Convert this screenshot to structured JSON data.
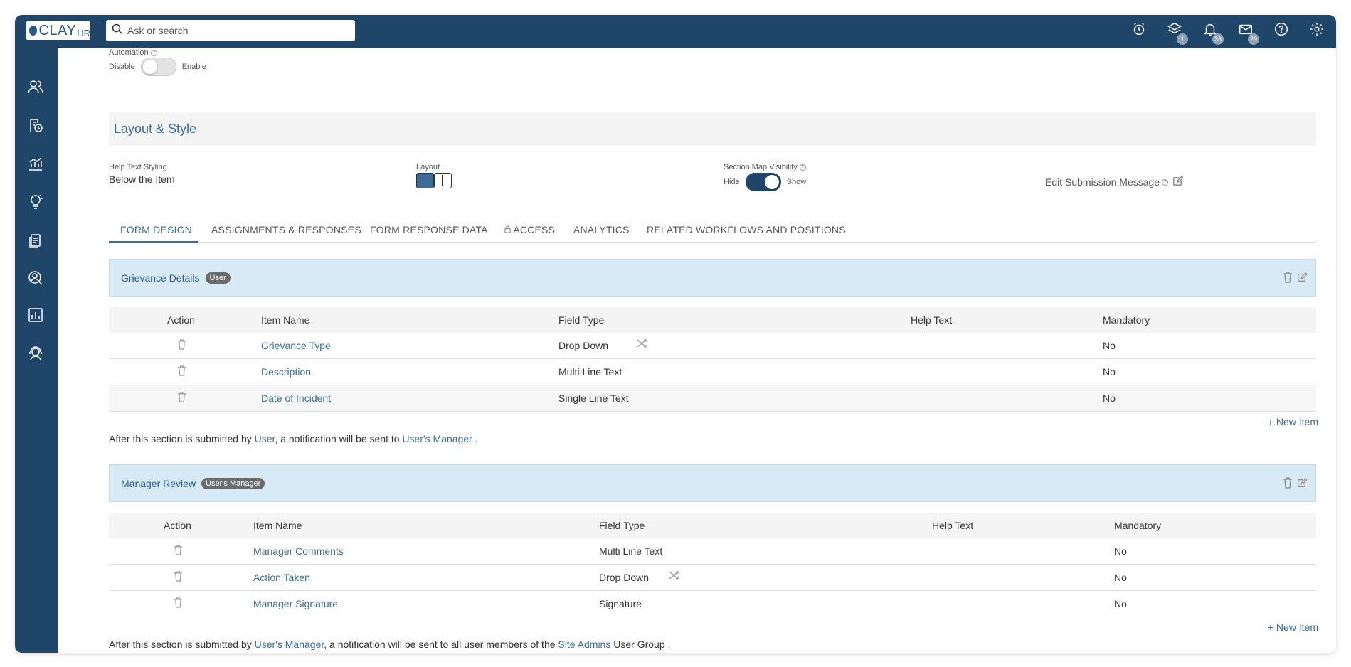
{
  "topbar": {
    "logo_text": "CLAY",
    "logo_suffix": "HR",
    "search_placeholder": "Ask or search",
    "layers_badge": "1",
    "bell_badge": "36",
    "mail_badge": "29"
  },
  "automation": {
    "label": "Automation",
    "off_label": "Disable",
    "on_label": "Enable"
  },
  "layout_style": {
    "title": "Layout & Style",
    "help_text_styling_label": "Help Text Styling",
    "help_text_styling_value": "Below the Item",
    "layout_label": "Layout",
    "section_map_label": "Section Map Visibility",
    "hide_label": "Hide",
    "show_label": "Show",
    "edit_submission_label": "Edit Submission Message"
  },
  "tabs": [
    {
      "label": "FORM DESIGN"
    },
    {
      "label": "ASSIGNMENTS & RESPONSES"
    },
    {
      "label": "FORM RESPONSE DATA"
    },
    {
      "label": "ACCESS"
    },
    {
      "label": "ANALYTICS"
    },
    {
      "label": "RELATED WORKFLOWS AND POSITIONS"
    }
  ],
  "columns": {
    "action": "Action",
    "item_name": "Item Name",
    "field_type": "Field Type",
    "help_text": "Help Text",
    "mandatory": "Mandatory"
  },
  "section1": {
    "title": "Grievance Details",
    "badge": "User",
    "rows": [
      {
        "name": "Grievance Type",
        "type": "Drop Down",
        "mandatory": "No"
      },
      {
        "name": "Description",
        "type": "Multi Line Text",
        "mandatory": "No"
      },
      {
        "name": "Date of Incident",
        "type": "Single Line Text",
        "mandatory": "No"
      }
    ],
    "new_item": "+ New Item",
    "note_pre": "After this section is submitted by ",
    "note_by": "User",
    "note_mid": ", a notification will be sent to ",
    "note_to": "User's Manager",
    "note_end": " ."
  },
  "section2": {
    "title": "Manager Review",
    "badge": "User's Manager",
    "rows": [
      {
        "name": "Manager Comments",
        "type": "Multi Line Text",
        "mandatory": "No"
      },
      {
        "name": "Action Taken",
        "type": "Drop Down",
        "mandatory": "No"
      },
      {
        "name": "Manager Signature",
        "type": "Signature",
        "mandatory": "No"
      }
    ],
    "new_item": "+ New Item",
    "note_pre": "After this section is submitted by ",
    "note_by": "User's Manager",
    "note_mid": ", a notification will be sent to all user members of the ",
    "note_to": "Site Admins",
    "note_end": " User Group ."
  }
}
